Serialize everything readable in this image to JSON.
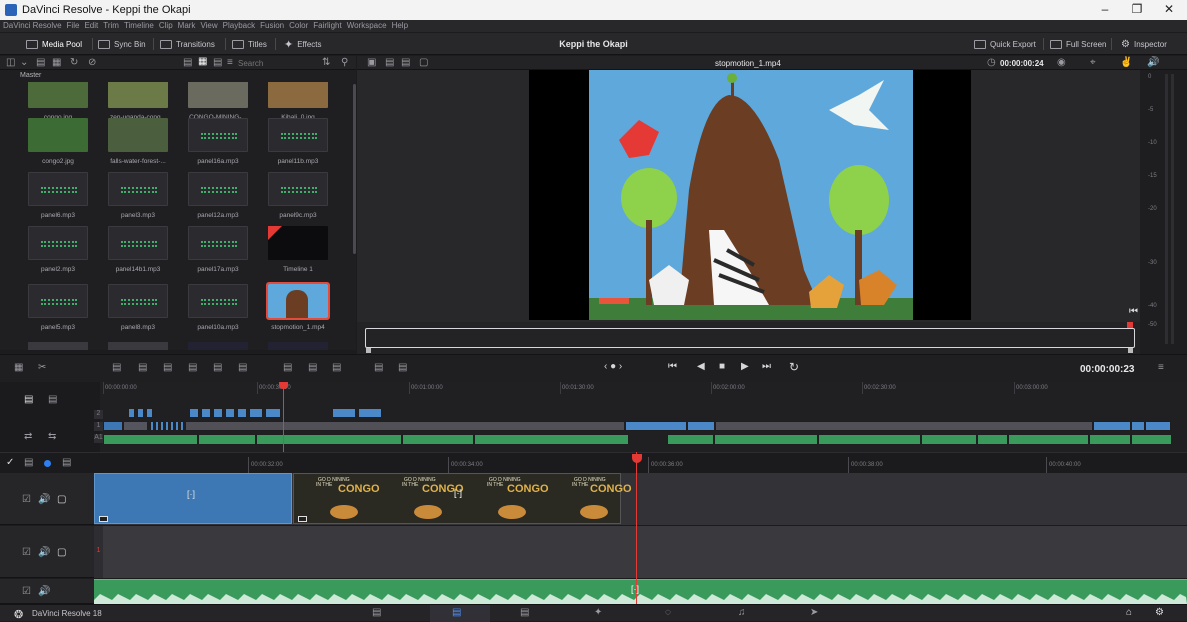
{
  "window": {
    "title": "DaVinci Resolve - Keppi the Okapi"
  },
  "menu": [
    "DaVinci Resolve",
    "File",
    "Edit",
    "Trim",
    "Timeline",
    "Clip",
    "Mark",
    "View",
    "Playback",
    "Fusion",
    "Color",
    "Fairlight",
    "Workspace",
    "Help"
  ],
  "toolbar": {
    "media_pool": "Media Pool",
    "sync_bin": "Sync Bin",
    "transitions": "Transitions",
    "titles": "Titles",
    "effects": "Effects",
    "project": "Keppi the Okapi",
    "quick_export": "Quick Export",
    "full_screen": "Full Screen",
    "inspector": "Inspector"
  },
  "pool": {
    "search": "Search",
    "bin": "Master",
    "clips": [
      {
        "name": "congo.jpg",
        "kind": "image",
        "color": "#4d6a3a"
      },
      {
        "name": "zen-uganda-cong...",
        "kind": "image",
        "color": "#6b7a46"
      },
      {
        "name": "CONGO-MINING-...",
        "kind": "image",
        "color": "#6a6a5e"
      },
      {
        "name": "Kibali_0.jpg",
        "kind": "image",
        "color": "#8a6a3e"
      },
      {
        "name": "congo2.jpg",
        "kind": "image",
        "color": "#3d6b34"
      },
      {
        "name": "falls-water-forest-...",
        "kind": "image",
        "color": "#4b5e3e"
      },
      {
        "name": "panel16a.mp3",
        "kind": "audio"
      },
      {
        "name": "panel11b.mp3",
        "kind": "audio"
      },
      {
        "name": "panel6.mp3",
        "kind": "audio"
      },
      {
        "name": "panel3.mp3",
        "kind": "audio"
      },
      {
        "name": "panel12a.mp3",
        "kind": "audio"
      },
      {
        "name": "panel9c.mp3",
        "kind": "audio"
      },
      {
        "name": "panel2.mp3",
        "kind": "audio"
      },
      {
        "name": "panel14b1.mp3",
        "kind": "audio"
      },
      {
        "name": "panel17a.mp3",
        "kind": "audio"
      },
      {
        "name": "Timeline 1",
        "kind": "timeline"
      },
      {
        "name": "panel5.mp3",
        "kind": "audio"
      },
      {
        "name": "panel8.mp3",
        "kind": "audio"
      },
      {
        "name": "panel10a.mp3",
        "kind": "audio"
      },
      {
        "name": "stopmotion_1.mp4",
        "kind": "video",
        "selected": true
      }
    ]
  },
  "viewer": {
    "clip_name": "stopmotion_1.mp4",
    "source_tc": "00:00:00:24",
    "record_tc": "00:00:00:23"
  },
  "meter": {
    "labels": [
      "0",
      "-5",
      "-10",
      "-15",
      "-20",
      "-30",
      "-40",
      "-50"
    ]
  },
  "mini_ruler": [
    "00:00:00:00",
    "00:00:30:00",
    "00:01:00:00",
    "00:01:30:00",
    "00:02:00:00",
    "00:02:30:00",
    "00:03:00:00"
  ],
  "tl_ruler": [
    "00:00:32:00",
    "00:00:34:00",
    "00:00:36:00",
    "00:00:38:00",
    "00:00:40:00"
  ],
  "tracks": {
    "v2": "2",
    "v1": "1",
    "a1": "A1"
  },
  "clip_title": {
    "line1": "GO D NINING",
    "line2": "IN THE",
    "line3": "CONGO"
  },
  "status": {
    "app": "DaVinci Resolve 18"
  },
  "colors": {
    "accent": "#e53935",
    "audio": "#3a9a5c",
    "video": "#3d7bb8"
  }
}
